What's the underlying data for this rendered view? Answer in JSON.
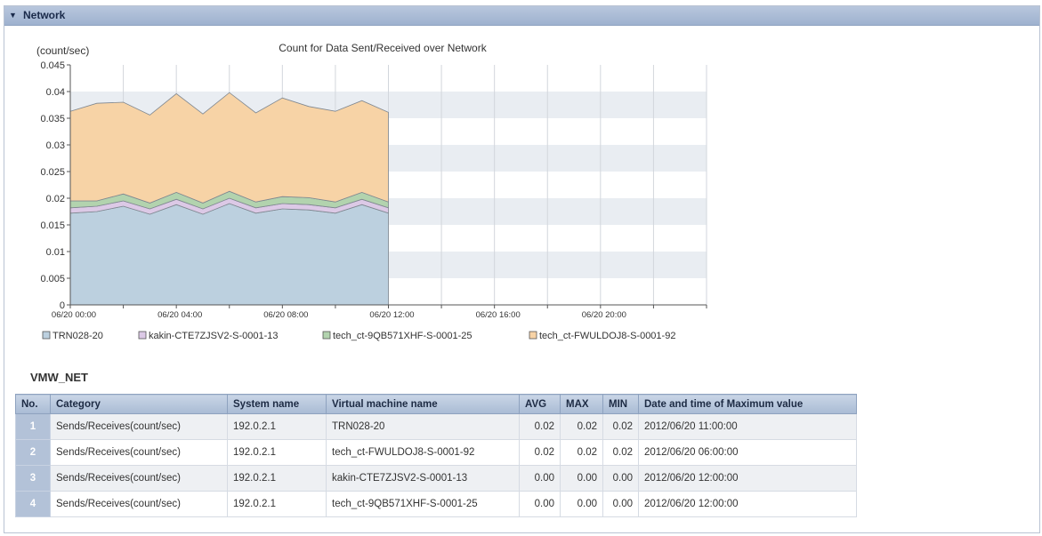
{
  "section": {
    "title": "Network",
    "toggle_icon": "collapse-triangle-icon"
  },
  "chart_data": {
    "type": "area",
    "stacked": true,
    "title": "Count for Data Sent/Received over Network",
    "ylabel": "(count/sec)",
    "xlabel": "",
    "ylim": [
      0,
      0.045
    ],
    "yticks": [
      "0",
      "0.005",
      "0.01",
      "0.015",
      "0.02",
      "0.025",
      "0.03",
      "0.035",
      "0.04",
      "0.045"
    ],
    "xlim": [
      0,
      24
    ],
    "xticks": [
      {
        "x": 0,
        "label": "06/20 00:00"
      },
      {
        "x": 4,
        "label": "06/20 04:00"
      },
      {
        "x": 8,
        "label": "06/20 08:00"
      },
      {
        "x": 12,
        "label": "06/20 12:00"
      },
      {
        "x": 16,
        "label": "06/20 16:00"
      },
      {
        "x": 20,
        "label": "06/20 20:00"
      }
    ],
    "x": [
      0,
      1,
      2,
      3,
      4,
      5,
      6,
      7,
      8,
      9,
      10,
      11,
      12
    ],
    "series": [
      {
        "name": "TRN028-20",
        "color": "#bcd0df",
        "values": [
          0.0172,
          0.0175,
          0.0185,
          0.017,
          0.0188,
          0.017,
          0.019,
          0.0172,
          0.018,
          0.0178,
          0.0172,
          0.0188,
          0.0172
        ]
      },
      {
        "name": "kakin-CTE7ZJSV2-S-0001-13",
        "color": "#dcc9e6",
        "values": [
          0.001,
          0.001,
          0.001,
          0.001,
          0.001,
          0.001,
          0.001,
          0.001,
          0.001,
          0.001,
          0.001,
          0.001,
          0.001
        ]
      },
      {
        "name": "tech_ct-9QB571XHF-S-0001-25",
        "color": "#b2d3ae",
        "values": [
          0.0013,
          0.001,
          0.0013,
          0.0011,
          0.0013,
          0.0011,
          0.0013,
          0.0011,
          0.0013,
          0.0013,
          0.0011,
          0.0013,
          0.0011
        ]
      },
      {
        "name": "tech_ct-FWULDOJ8-S-0001-92",
        "color": "#f7d3a6",
        "values": [
          0.0168,
          0.0183,
          0.0172,
          0.0165,
          0.0185,
          0.0167,
          0.0185,
          0.0167,
          0.0185,
          0.0171,
          0.017,
          0.0172,
          0.0168
        ]
      }
    ],
    "grid": true,
    "legend_position": "bottom"
  },
  "table": {
    "title": "VMW_NET",
    "headers": [
      "No.",
      "Category",
      "System name",
      "Virtual machine name",
      "AVG",
      "MAX",
      "MIN",
      "Date and time of Maximum value"
    ],
    "rows": [
      [
        "1",
        "Sends/Receives(count/sec)",
        "192.0.2.1",
        "TRN028-20",
        "0.02",
        "0.02",
        "0.02",
        "2012/06/20 11:00:00"
      ],
      [
        "2",
        "Sends/Receives(count/sec)",
        "192.0.2.1",
        "tech_ct-FWULDOJ8-S-0001-92",
        "0.02",
        "0.02",
        "0.02",
        "2012/06/20 06:00:00"
      ],
      [
        "3",
        "Sends/Receives(count/sec)",
        "192.0.2.1",
        "kakin-CTE7ZJSV2-S-0001-13",
        "0.00",
        "0.00",
        "0.00",
        "2012/06/20 12:00:00"
      ],
      [
        "4",
        "Sends/Receives(count/sec)",
        "192.0.2.1",
        "tech_ct-9QB571XHF-S-0001-25",
        "0.00",
        "0.00",
        "0.00",
        "2012/06/20 12:00:00"
      ]
    ]
  }
}
